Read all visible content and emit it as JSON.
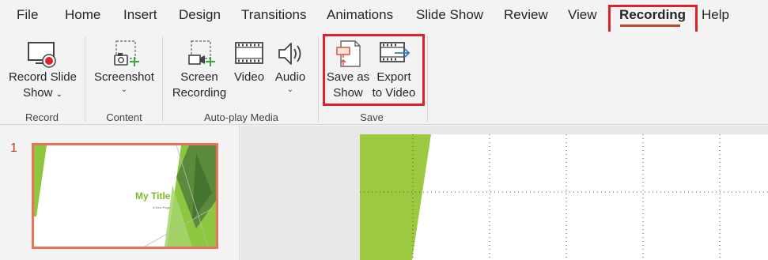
{
  "tabs": [
    {
      "label": "File"
    },
    {
      "label": "Home"
    },
    {
      "label": "Insert"
    },
    {
      "label": "Design"
    },
    {
      "label": "Transitions"
    },
    {
      "label": "Animations"
    },
    {
      "label": "Slide Show"
    },
    {
      "label": "Review"
    },
    {
      "label": "View"
    },
    {
      "label": "Recording",
      "active": true
    },
    {
      "label": "Help"
    }
  ],
  "ribbon": {
    "record": {
      "button_line1": "Record Slide",
      "button_line2": "Show",
      "group_label": "Record"
    },
    "content": {
      "button_label": "Screenshot",
      "group_label": "Content"
    },
    "media": {
      "screen_line1": "Screen",
      "screen_line2": "Recording",
      "video_label": "Video",
      "audio_label": "Audio",
      "group_label": "Auto-play Media"
    },
    "save": {
      "save_line1": "Save as",
      "save_line2": "Show",
      "export_line1": "Export",
      "export_line2": "to Video",
      "group_label": "Save"
    }
  },
  "slides": {
    "number": "1",
    "thumb_title": "My Title",
    "thumb_subtitle": "A New Page"
  },
  "colors": {
    "highlight": "#e0202a",
    "accent_orange": "#c43e1c",
    "slide_green": "#8dc63f",
    "slide_dark_green": "#5b8a3a"
  }
}
